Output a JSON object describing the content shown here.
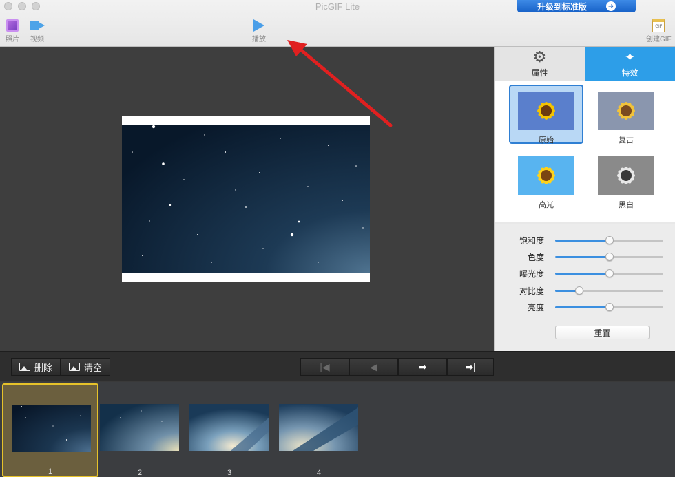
{
  "window": {
    "title": "PicGIF Lite",
    "upgrade_label": "升级到标准版"
  },
  "toolbar": {
    "photo_label": "照片",
    "video_label": "视频",
    "play_label": "播放",
    "create_gif_label": "创建GIF",
    "gif_icon_text": "GIF"
  },
  "panel": {
    "tabs": [
      {
        "label": "属性",
        "icon": "gear-icon"
      },
      {
        "label": "特效",
        "icon": "magic-wand-icon"
      }
    ],
    "active_tab": "特效",
    "effects": [
      {
        "label": "原始",
        "selected": true
      },
      {
        "label": "复古",
        "selected": false
      },
      {
        "label": "高光",
        "selected": false
      },
      {
        "label": "黑白",
        "selected": false
      }
    ],
    "sliders": [
      {
        "label": "饱和度",
        "value": 0.5
      },
      {
        "label": "色度",
        "value": 0.5
      },
      {
        "label": "曝光度",
        "value": 0.5
      },
      {
        "label": "对比度",
        "value": 0.22
      },
      {
        "label": "亮度",
        "value": 0.5
      }
    ],
    "reset_label": "重置"
  },
  "controls": {
    "delete_label": "删除",
    "clear_label": "清空",
    "nav_icons": [
      "skip-first-icon",
      "previous-icon",
      "next-icon",
      "skip-last-icon"
    ]
  },
  "frames": [
    {
      "number": "1",
      "selected": true
    },
    {
      "number": "2",
      "selected": false
    },
    {
      "number": "3",
      "selected": false
    },
    {
      "number": "4",
      "selected": false
    }
  ],
  "colors": {
    "accent": "#2d9ee8",
    "selection_frame": "#e6c22a",
    "annotation_arrow": "#e02020"
  }
}
